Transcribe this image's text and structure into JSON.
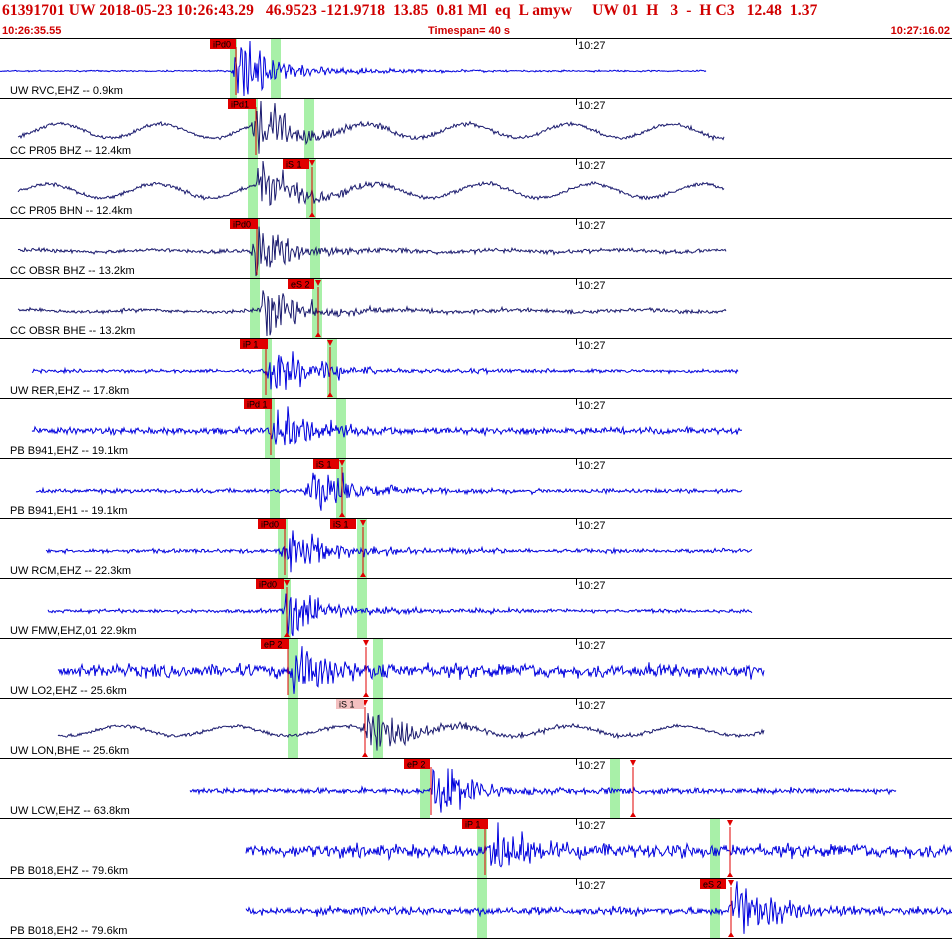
{
  "header": {
    "title": "61391701 UW 2018-05-23 10:26:43.29   46.9523 -121.9718  13.85  0.81 Ml  eq  L amyw     UW 01  H   3  -  H C3   12.48  1.37",
    "start_time": "10:26:35.55",
    "timespan": "Timespan=  40 s",
    "end_time": "10:27:16.02"
  },
  "time_tick_label": "10:27",
  "colors": {
    "pick": "#e00000",
    "pick_light": "#f4c0c0",
    "window": "#a8f0a8",
    "trace_blue": "#0000dd",
    "trace_dark": "#1a1a6e",
    "text_red": "#d00000"
  },
  "channels": [
    {
      "label": "UW RVC,EHZ -- 0.9km",
      "color": "trace_blue",
      "picks": [
        {
          "label": "iPd0"
        }
      ]
    },
    {
      "label": "CC PR05 BHZ -- 12.4km",
      "color": "trace_dark",
      "picks": [
        {
          "label": "iPd1"
        }
      ]
    },
    {
      "label": "CC PR05 BHN -- 12.4km",
      "color": "trace_dark",
      "picks": [
        {
          "label": "iS 1"
        }
      ]
    },
    {
      "label": "CC OBSR BHZ -- 13.2km",
      "color": "trace_dark",
      "picks": [
        {
          "label": "iPd0"
        }
      ]
    },
    {
      "label": "CC OBSR BHE -- 13.2km",
      "color": "trace_dark",
      "picks": [
        {
          "label": "eS 2"
        }
      ]
    },
    {
      "label": "UW RER,EHZ -- 17.8km",
      "color": "trace_blue",
      "picks": [
        {
          "label": "iP 1"
        }
      ]
    },
    {
      "label": "PB B941,EHZ -- 19.1km",
      "color": "trace_blue",
      "picks": [
        {
          "label": "iPd 1"
        }
      ]
    },
    {
      "label": "PB B941,EH1 -- 19.1km",
      "color": "trace_blue",
      "picks": [
        {
          "label": "iS 1"
        }
      ]
    },
    {
      "label": "UW RCM,EHZ -- 22.3km",
      "color": "trace_blue",
      "picks": [
        {
          "label": "iPd0"
        },
        {
          "label": "iS 1"
        }
      ]
    },
    {
      "label": "UW FMW,EHZ,01 22.9km",
      "color": "trace_blue",
      "picks": [
        {
          "label": "iPd0"
        }
      ]
    },
    {
      "label": "UW LO2,EHZ -- 25.6km",
      "color": "trace_blue",
      "picks": [
        {
          "label": "eP 2"
        }
      ]
    },
    {
      "label": "UW LON,BHE -- 25.6km",
      "color": "trace_dark",
      "picks": [
        {
          "label": "iS 1"
        }
      ]
    },
    {
      "label": "UW LCW,EHZ -- 63.8km",
      "color": "trace_blue",
      "picks": [
        {
          "label": "eP 2"
        }
      ]
    },
    {
      "label": "PB B018,EHZ -- 79.6km",
      "color": "trace_blue",
      "picks": [
        {
          "label": "iP 1"
        }
      ]
    },
    {
      "label": "PB B018,EH2 -- 79.6km",
      "color": "trace_blue",
      "picks": [
        {
          "label": "eS 2"
        }
      ]
    }
  ]
}
